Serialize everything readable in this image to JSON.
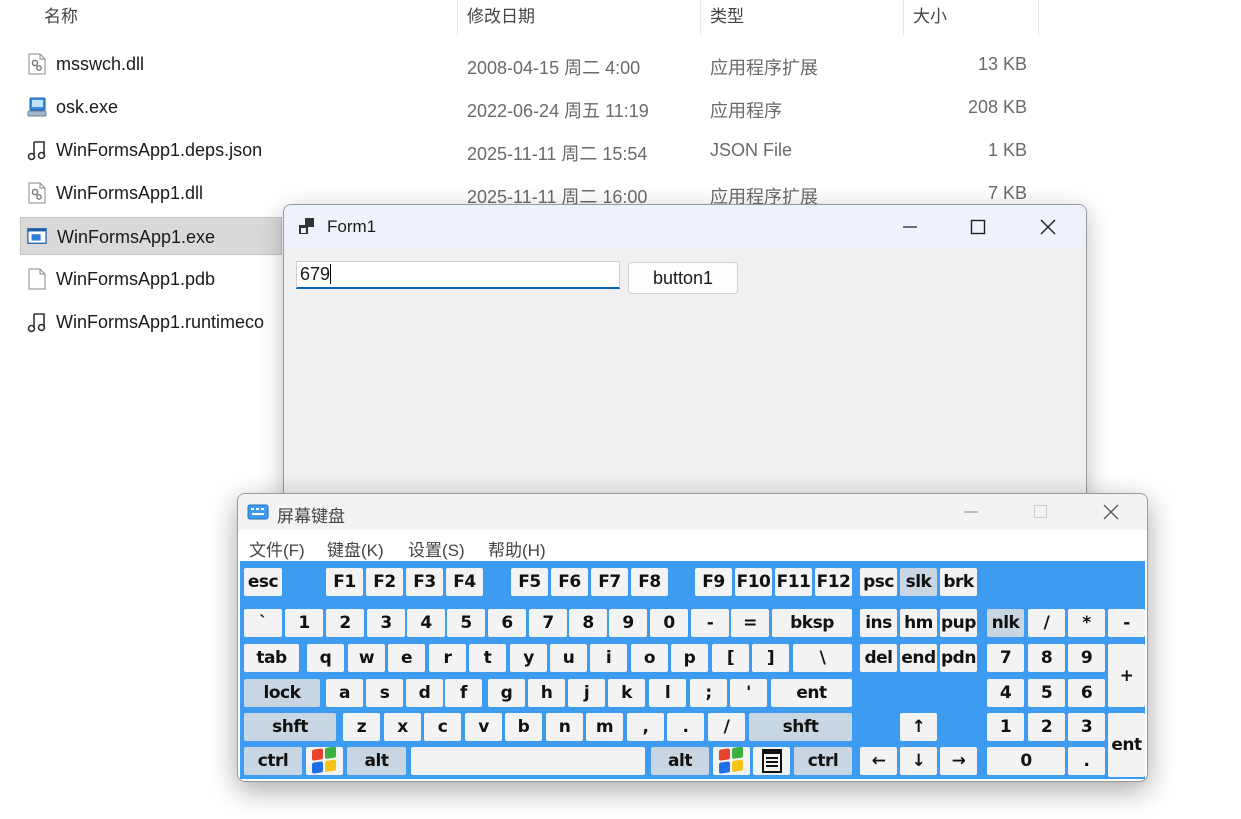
{
  "explorer": {
    "columns": {
      "name": "名称",
      "modified": "修改日期",
      "type": "类型",
      "size": "大小"
    },
    "files": [
      {
        "name": "msswch.dll",
        "modified": "2008-04-15 周二 4:00",
        "type": "应用程序扩展",
        "size": "13 KB",
        "icon": "dll-file-icon"
      },
      {
        "name": "osk.exe",
        "modified": "2022-06-24 周五 11:19",
        "type": "应用程序",
        "size": "208 KB",
        "icon": "exe-app-icon"
      },
      {
        "name": "WinFormsApp1.deps.json",
        "modified": "2025-11-11 周二 15:54",
        "type": "JSON File",
        "size": "1 KB",
        "icon": "json-file-icon"
      },
      {
        "name": "WinFormsApp1.dll",
        "modified": "2025-11-11 周二 16:00",
        "type": "应用程序扩展",
        "size": "7 KB",
        "icon": "dll-file-icon"
      },
      {
        "name": "WinFormsApp1.exe",
        "icon": "window-app-icon",
        "selected": true
      },
      {
        "name": "WinFormsApp1.pdb",
        "icon": "blank-file-icon"
      },
      {
        "name": "WinFormsApp1.runtimeco",
        "icon": "json-file-icon"
      }
    ]
  },
  "form1": {
    "title": "Form1",
    "textbox_value": "679",
    "button_label": "button1"
  },
  "osk": {
    "title": "屏幕键盘",
    "menu": [
      "文件(F)",
      "键盘(K)",
      "设置(S)",
      "帮助(H)"
    ],
    "accent": "#3d9bf2",
    "keys": {
      "esc": "esc",
      "f1": "F1",
      "f2": "F2",
      "f3": "F3",
      "f4": "F4",
      "f5": "F5",
      "f6": "F6",
      "f7": "F7",
      "f8": "F8",
      "f9": "F9",
      "f10": "F10",
      "f11": "F11",
      "f12": "F12",
      "psc": "psc",
      "slk": "slk",
      "brk": "brk",
      "backtick": "`",
      "d1": "1",
      "d2": "2",
      "d3": "3",
      "d4": "4",
      "d5": "5",
      "d6": "6",
      "d7": "7",
      "d8": "8",
      "d9": "9",
      "d0": "0",
      "minus": "-",
      "equals": "=",
      "bksp": "bksp",
      "ins": "ins",
      "hm": "hm",
      "pup": "pup",
      "nlk": "nlk",
      "np_slash": "/",
      "np_star": "*",
      "np_minus": "-",
      "tab": "tab",
      "q": "q",
      "w": "w",
      "e": "e",
      "r": "r",
      "t": "t",
      "y": "y",
      "u": "u",
      "i": "i",
      "o": "o",
      "p": "p",
      "lbracket": "[",
      "rbracket": "]",
      "backslash": "\\",
      "del": "del",
      "end": "end",
      "pdn": "pdn",
      "np7": "7",
      "np8": "8",
      "np9": "9",
      "np_plus": "+",
      "lock": "lock",
      "a": "a",
      "s": "s",
      "d": "d",
      "f": "f",
      "g": "g",
      "h": "h",
      "j": "j",
      "k": "k",
      "l": "l",
      "semicolon": ";",
      "quote": "'",
      "ent": "ent",
      "np4": "4",
      "np5": "5",
      "np6": "6",
      "lshft": "shft",
      "z": "z",
      "x": "x",
      "c": "c",
      "v": "v",
      "b": "b",
      "n": "n",
      "m": "m",
      "comma": ",",
      "period": ".",
      "slash": "/",
      "rshft": "shft",
      "up": "↑",
      "np1": "1",
      "np2": "2",
      "np3": "3",
      "np_ent": "ent",
      "lctrl": "ctrl",
      "lalt": "alt",
      "space": "",
      "ralt": "alt",
      "rctrl": "ctrl",
      "left": "←",
      "down": "↓",
      "right": "→",
      "np0": "0",
      "np_dot": "."
    }
  }
}
